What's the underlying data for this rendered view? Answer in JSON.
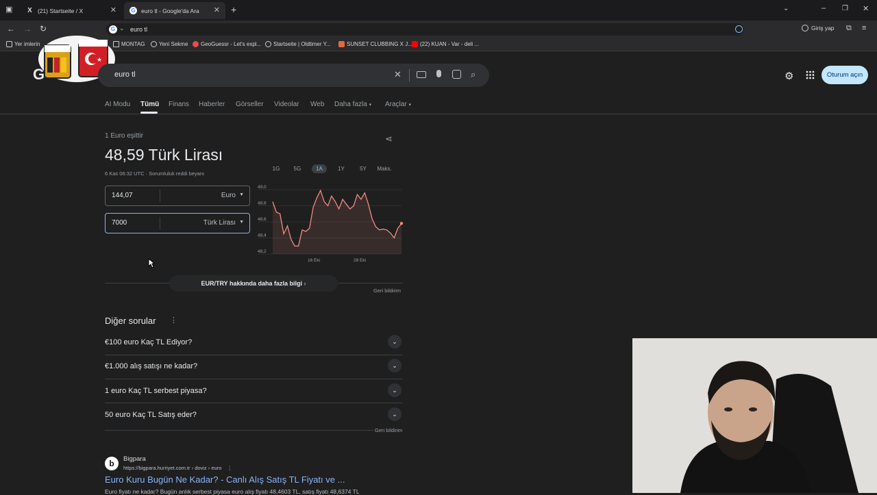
{
  "tabs": [
    {
      "title": "(21) Startseite / X",
      "favicon": "x-logo"
    },
    {
      "title": "euro tl - Google'da Ara",
      "favicon": "google-logo"
    }
  ],
  "address_bar": {
    "url": "euro tl"
  },
  "toolbar": {
    "signin_label": "Giriş yap"
  },
  "bookmarks": [
    {
      "label": "Yer imlerin"
    },
    {
      "label": "MONTAG"
    },
    {
      "label": "Yeni Sekme"
    },
    {
      "label": "GeoGuessr - Let's expl..."
    },
    {
      "label": "Startseite | Oldtimer Y..."
    },
    {
      "label": "SUNSET CLUBBING X J..."
    },
    {
      "label": "(22) KUAN - Var - deli ..."
    }
  ],
  "search": {
    "query": "euro tl",
    "signin_button": "Oturum açın"
  },
  "nav_tabs": [
    {
      "label": "AI Modu"
    },
    {
      "label": "Tümü"
    },
    {
      "label": "Finans"
    },
    {
      "label": "Haberler"
    },
    {
      "label": "Görseller"
    },
    {
      "label": "Videolar"
    },
    {
      "label": "Web"
    },
    {
      "label": "Daha fazla"
    },
    {
      "label": "Araçlar"
    }
  ],
  "converter": {
    "equals_label": "1 Euro eşittir",
    "result": "48,59 Türk Lirası",
    "timestamp": "6 Kas 06:32 UTC",
    "disclaimer": "Sorumluluk reddi beyanı",
    "amount_from": "144,07",
    "currency_from": "Euro",
    "amount_to": "7000",
    "currency_to": "Türk Lirası",
    "more_info": "EUR/TRY hakkında daha fazla bilgi",
    "feedback": "Geri bildirim"
  },
  "ranges": [
    "1G",
    "5G",
    "1A",
    "1Y",
    "5Y",
    "Maks."
  ],
  "chart_data": {
    "type": "line",
    "x_tick_labels": [
      "16 Eki",
      "28 Eki"
    ],
    "y_ticks": [
      "49,0",
      "48,8",
      "48,6",
      "48,4",
      "48,2"
    ],
    "ylim": [
      48.2,
      49.0
    ],
    "values": [
      48.85,
      48.72,
      48.7,
      48.45,
      48.55,
      48.38,
      48.3,
      48.3,
      48.5,
      48.48,
      48.52,
      48.78,
      48.9,
      48.99,
      48.85,
      48.8,
      48.92,
      48.85,
      48.76,
      48.88,
      48.82,
      48.76,
      48.8,
      48.94,
      48.88,
      48.96,
      48.82,
      48.64,
      48.54,
      48.5,
      48.51,
      48.5,
      48.46,
      48.4,
      48.52,
      48.58
    ],
    "color": "#f28b82"
  },
  "other_questions": {
    "title": "Diğer sorular",
    "items": [
      {
        "q": "€100 euro Kaç TL Ediyor?"
      },
      {
        "q": "€1.000 alış satışı ne kadar?"
      },
      {
        "q": "1 euro Kaç TL serbest piyasa?"
      },
      {
        "q": "50 euro Kaç TL Satış eder?"
      }
    ],
    "feedback": "Geri bildirim"
  },
  "result": {
    "site": "Bigpara",
    "breadcrumb": "https://bigpara.hurriyet.com.tr › doviz › euro",
    "title": "Euro Kuru Bugün Ne Kadar? - Canlı Alış Satış TL Fiyatı ve ...",
    "snippet": "Euro fiyatı ne kadar? Bugün anlık serbest piyasa euro alış fiyatı 48,4603 TL, satış fiyatı 48,6374 TL"
  },
  "colors": {
    "bg": "#1f1f1f",
    "link": "#8ab4f8",
    "accent": "#c2e7ff"
  }
}
